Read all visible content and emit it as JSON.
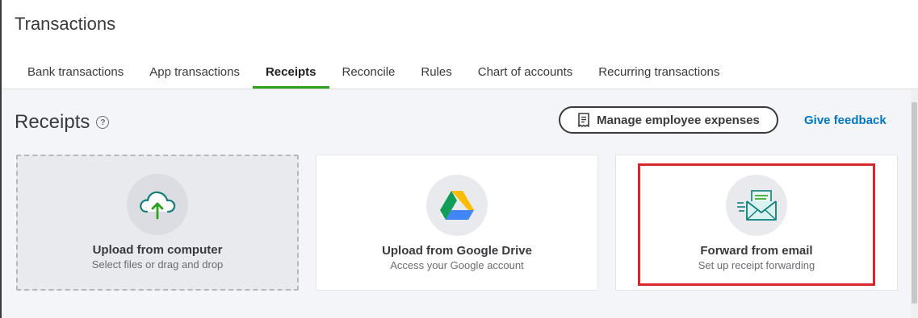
{
  "page": {
    "title": "Transactions"
  },
  "tabs": [
    {
      "label": "Bank transactions"
    },
    {
      "label": "App transactions"
    },
    {
      "label": "Receipts"
    },
    {
      "label": "Reconcile"
    },
    {
      "label": "Rules"
    },
    {
      "label": "Chart of accounts"
    },
    {
      "label": "Recurring transactions"
    }
  ],
  "active_tab": "Receipts",
  "section": {
    "title": "Receipts",
    "help_icon": "?",
    "manage_button": "Manage employee expenses",
    "feedback_link": "Give feedback"
  },
  "cards": [
    {
      "icon": "cloud-upload-icon",
      "title": "Upload from computer",
      "subtitle": "Select files or drag and drop"
    },
    {
      "icon": "google-drive-icon",
      "title": "Upload from Google Drive",
      "subtitle": "Access your Google account"
    },
    {
      "icon": "email-forward-icon",
      "title": "Forward from email",
      "subtitle": "Set up receipt forwarding"
    }
  ],
  "colors": {
    "accent_green": "#2ca01c",
    "link_blue": "#0077c5",
    "highlight_red": "#d9262b",
    "text_dark": "#393a3d"
  }
}
